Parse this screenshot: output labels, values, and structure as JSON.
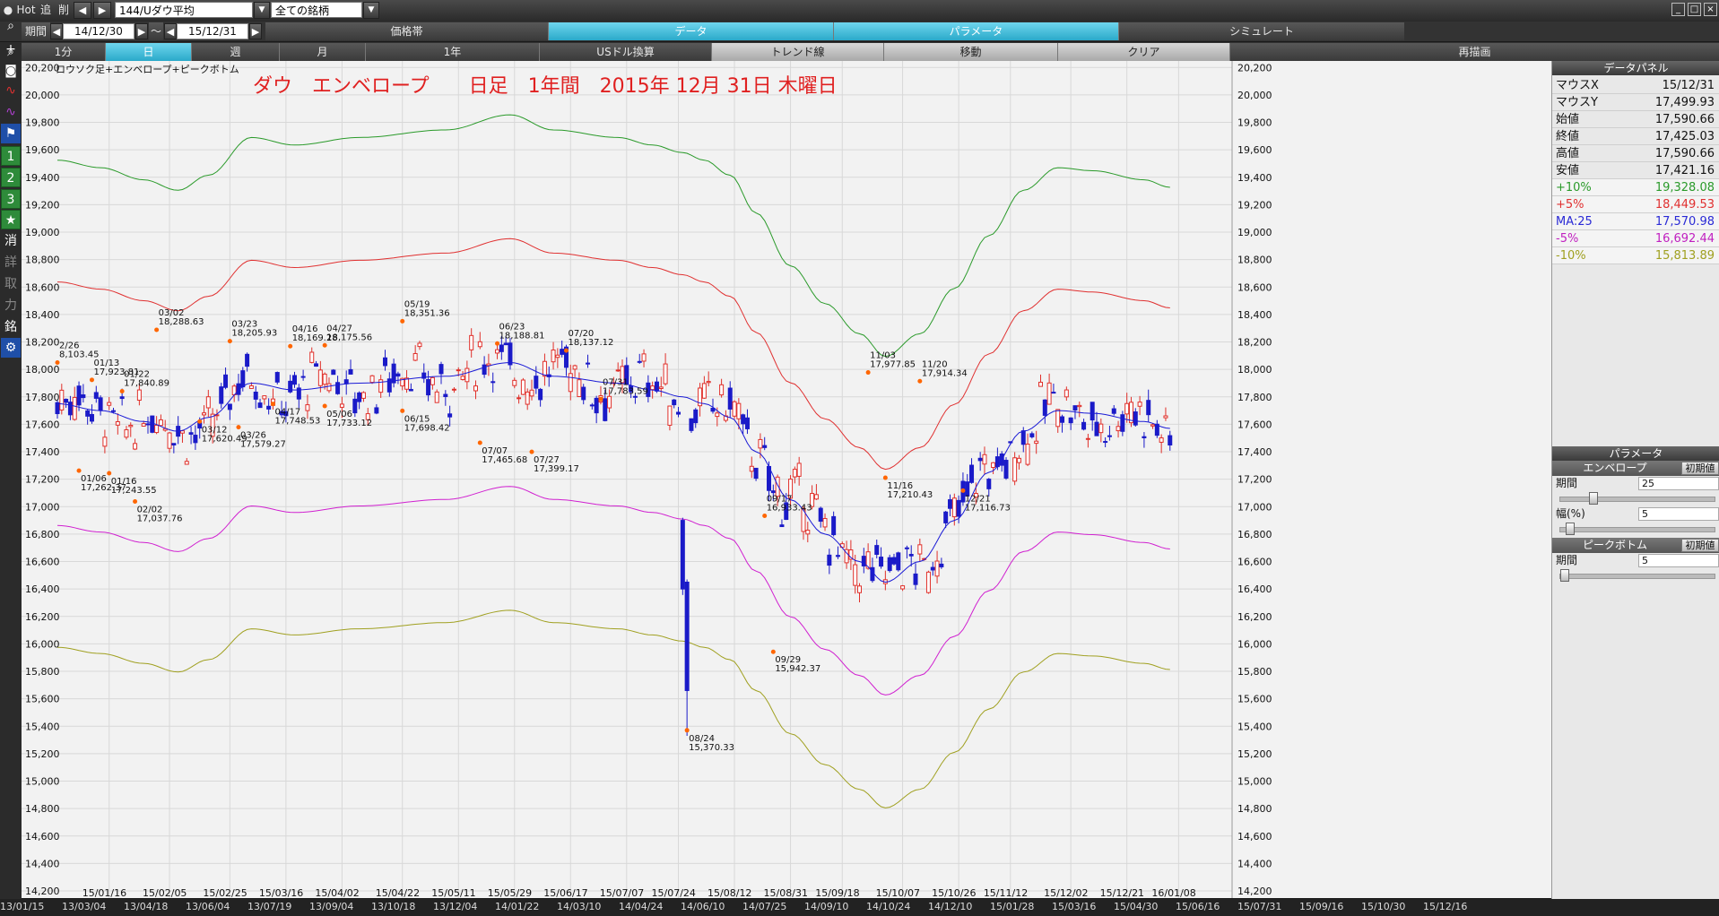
{
  "toolbar": {
    "hot": "Hot",
    "add": "追",
    "del": "削",
    "symbol": "144/Uダウ平均",
    "universe": "全ての銘柄"
  },
  "row2": {
    "period_label": "期間",
    "start_date": "14/12/30",
    "tilde": "～",
    "end_date": "15/12/31",
    "tabs": [
      "価格帯",
      "データ",
      "パラメータ",
      "シミュレート"
    ]
  },
  "row3": {
    "buttons": [
      "1分",
      "日",
      "週",
      "月",
      "1年",
      "USドル換算",
      "トレンド線",
      "移動",
      "クリア",
      "再描画"
    ]
  },
  "left_toolbar": {
    "num1": "1",
    "num2": "2",
    "num3": "3",
    "kanji": [
      "消",
      "詳",
      "取",
      "力",
      "銘"
    ]
  },
  "chart": {
    "indicator_label": "ロウソク足+エンベロープ+ピークボトム",
    "title": "ダウ　エンベロープ　　日足　1年間　2015年 12月 31日 木曜日",
    "bottom_corner_labels": [
      "14,400",
      "14,200"
    ]
  },
  "bottom_axis": [
    "13/01/15",
    "13/03/04",
    "13/04/18",
    "13/06/04",
    "13/07/19",
    "13/09/04",
    "13/10/18",
    "13/12/04",
    "14/01/22",
    "14/03/10",
    "14/04/24",
    "14/06/10",
    "14/07/25",
    "14/09/10",
    "14/10/24",
    "14/12/10",
    "15/01/28",
    "15/03/16",
    "15/04/30",
    "15/06/16",
    "15/07/31",
    "15/09/16",
    "15/10/30",
    "15/12/16"
  ],
  "colors": {
    "up_candle": "#e0302a",
    "down_candle": "#1a1ac8",
    "ma": "#1a1ad6",
    "env_plus10": "#2a9a2a",
    "env_plus5": "#e03030",
    "env_minus5": "#d020d0",
    "env_minus10": "#a0a020",
    "peak_marker": "#ff6600"
  },
  "panel": {
    "data_header": "データパネル",
    "rows": [
      {
        "k": "マウスX",
        "v": "15/12/31"
      },
      {
        "k": "マウスY",
        "v": "17,499.93"
      },
      {
        "k": "始値",
        "v": "17,590.66"
      },
      {
        "k": "終値",
        "v": "17,425.03"
      },
      {
        "k": "高値",
        "v": "17,590.66"
      },
      {
        "k": "安値",
        "v": "17,421.16"
      }
    ],
    "env_rows": [
      {
        "k": "+10%",
        "v": "19,328.08",
        "color": "#2a9a2a"
      },
      {
        "k": "+5%",
        "v": "18,449.53",
        "color": "#e03030"
      },
      {
        "k": "MA:25",
        "v": "17,570.98",
        "color": "#2a2ad6"
      },
      {
        "k": "-5%",
        "v": "16,692.44",
        "color": "#c020c0"
      },
      {
        "k": "-10%",
        "v": "15,813.89",
        "color": "#a0a020"
      }
    ],
    "param_header": "パラメータ",
    "envelope_label": "エンベロープ",
    "init_label": "初期値",
    "period_label": "期間",
    "period_value": "25",
    "width_label": "幅(%)",
    "width_value": "5",
    "peak_label": "ピークボトム",
    "peak_period_label": "期間",
    "peak_period_value": "5"
  },
  "chart_data": {
    "type": "candlestick",
    "ylim": [
      14200,
      20300
    ],
    "yticks": [
      14200,
      14400,
      14600,
      14800,
      15000,
      15200,
      15400,
      15600,
      15800,
      16000,
      16200,
      16400,
      16600,
      16800,
      17000,
      17200,
      17400,
      17600,
      17800,
      18000,
      18200,
      18400,
      18600,
      18800,
      19000,
      19200,
      19400,
      19600,
      19800,
      20000,
      20200
    ],
    "x_ticks": [
      "15/01/16",
      "15/02/05",
      "15/02/25",
      "15/03/16",
      "15/04/02",
      "15/04/22",
      "15/05/11",
      "15/05/29",
      "15/06/17",
      "15/07/07",
      "15/07/24",
      "15/08/12",
      "15/08/31",
      "15/09/18",
      "15/10/07",
      "15/10/26",
      "15/11/12",
      "15/12/02",
      "15/12/21",
      "16/01/08"
    ],
    "x_tick_index": [
      12,
      26,
      40,
      53,
      66,
      80,
      93,
      106,
      119,
      132,
      144,
      157,
      170,
      182,
      196,
      209,
      221,
      235,
      248,
      260
    ],
    "n_days": 262,
    "ma_anchors": [
      [
        0,
        17750
      ],
      [
        10,
        17700
      ],
      [
        20,
        17620
      ],
      [
        28,
        17550
      ],
      [
        35,
        17650
      ],
      [
        45,
        17900
      ],
      [
        55,
        17850
      ],
      [
        70,
        17900
      ],
      [
        90,
        17950
      ],
      [
        105,
        18050
      ],
      [
        115,
        17950
      ],
      [
        130,
        17900
      ],
      [
        138,
        17850
      ],
      [
        145,
        17800
      ],
      [
        150,
        17750
      ],
      [
        156,
        17650
      ],
      [
        162,
        17400
      ],
      [
        170,
        17050
      ],
      [
        178,
        16800
      ],
      [
        186,
        16600
      ],
      [
        192,
        16450
      ],
      [
        200,
        16600
      ],
      [
        208,
        16900
      ],
      [
        216,
        17250
      ],
      [
        224,
        17550
      ],
      [
        232,
        17700
      ],
      [
        240,
        17680
      ],
      [
        252,
        17620
      ],
      [
        258,
        17570
      ]
    ],
    "peaks": [
      {
        "i": 0,
        "date": "2/26",
        "value": "8,103.45",
        "type": "peak"
      },
      {
        "i": 8,
        "date": "01/13",
        "value": "17,923.81",
        "type": "peak"
      },
      {
        "i": 15,
        "date": "01/22",
        "value": "17,840.89",
        "type": "peak"
      },
      {
        "i": 23,
        "date": "03/02",
        "value": "18,288.63",
        "type": "peak"
      },
      {
        "i": 40,
        "date": "03/23",
        "value": "18,205.93",
        "type": "peak"
      },
      {
        "i": 54,
        "date": "04/16",
        "value": "18,169.28",
        "type": "peak"
      },
      {
        "i": 62,
        "date": "04/27",
        "value": "18,175.56",
        "type": "peak"
      },
      {
        "i": 80,
        "date": "05/19",
        "value": "18,351.36",
        "type": "peak"
      },
      {
        "i": 102,
        "date": "06/23",
        "value": "18,188.81",
        "type": "peak"
      },
      {
        "i": 118,
        "date": "07/20",
        "value": "18,137.12",
        "type": "peak"
      },
      {
        "i": 126,
        "date": "07/31",
        "value": "17,783.59",
        "type": "peak"
      },
      {
        "i": 164,
        "date": "09/17",
        "value": "16,933.43",
        "type": "peak"
      },
      {
        "i": 188,
        "date": "11/03",
        "value": "17,977.85",
        "type": "peak"
      },
      {
        "i": 200,
        "date": "11/20",
        "value": "17,914.34",
        "type": "peak"
      },
      {
        "i": 5,
        "date": "01/06",
        "value": "17,262.37",
        "type": "bottom"
      },
      {
        "i": 12,
        "date": "01/16",
        "value": "17,243.55",
        "type": "bottom"
      },
      {
        "i": 18,
        "date": "02/02",
        "value": "17,037.76",
        "type": "bottom"
      },
      {
        "i": 33,
        "date": "03/12",
        "value": "17,620.49",
        "type": "bottom"
      },
      {
        "i": 42,
        "date": "03/26",
        "value": "17,579.27",
        "type": "bottom"
      },
      {
        "i": 50,
        "date": "04/17",
        "value": "17,748.53",
        "type": "bottom"
      },
      {
        "i": 62,
        "date": "05/06",
        "value": "17,733.12",
        "type": "bottom"
      },
      {
        "i": 80,
        "date": "06/15",
        "value": "17,698.42",
        "type": "bottom"
      },
      {
        "i": 98,
        "date": "07/07",
        "value": "17,465.68",
        "type": "bottom"
      },
      {
        "i": 110,
        "date": "07/27",
        "value": "17,399.17",
        "type": "bottom"
      },
      {
        "i": 146,
        "date": "08/24",
        "value": "15,370.33",
        "type": "bottom"
      },
      {
        "i": 166,
        "date": "09/29",
        "value": "15,942.37",
        "type": "bottom"
      },
      {
        "i": 192,
        "date": "11/16",
        "value": "17,210.43",
        "type": "bottom"
      },
      {
        "i": 210,
        "date": "12/21",
        "value": "17,116.73",
        "type": "bottom"
      }
    ]
  }
}
